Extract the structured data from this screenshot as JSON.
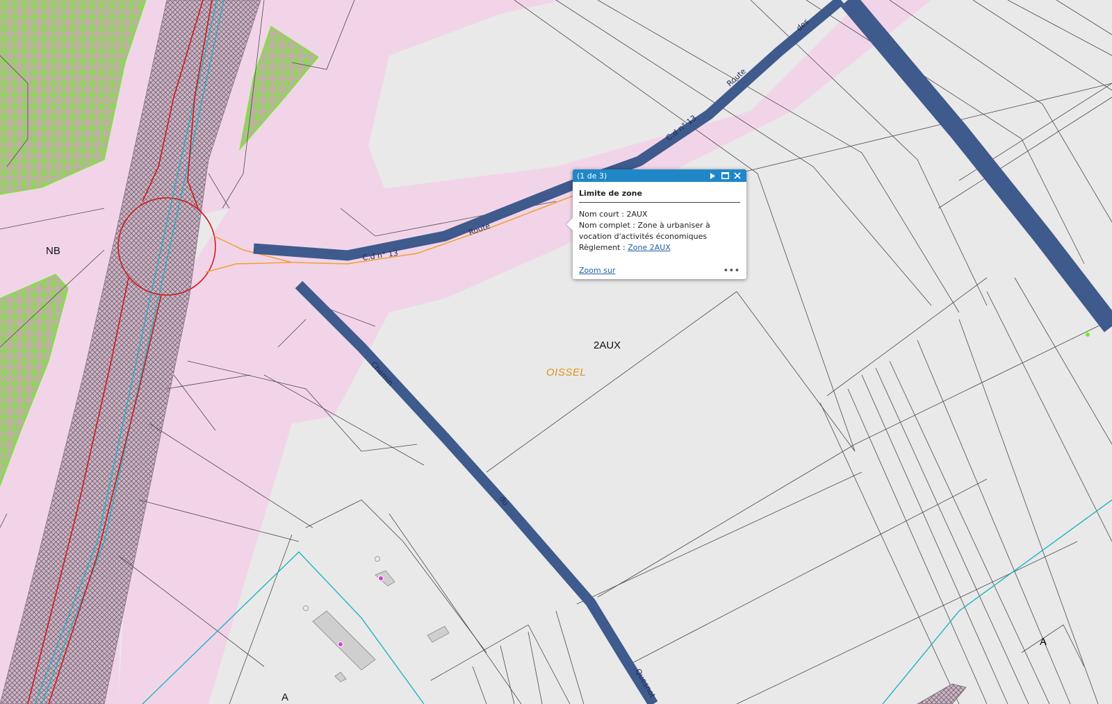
{
  "map": {
    "zones": [
      "NB",
      "2AUX",
      "A",
      "A"
    ],
    "commune": "OISSEL",
    "roads": {
      "cd13_a": "C.d n° 13",
      "route_a": "Route",
      "cd13_b": "C.d n° 13",
      "route_b": "Route",
      "des": "des",
      "chemin": "Chemin",
      "du": "du",
      "quesnot": "Quesnot"
    },
    "colors": {
      "background": "#e9e9e9",
      "pink_zone": "#f2d4e8",
      "road_blue": "#3f5a8c",
      "parcel_line": "#4a4a4a",
      "cyan_line": "#1fb3c4",
      "red_line": "#cf1a1a",
      "orange_line": "#f0a030",
      "green_wood": "#b9b49a"
    }
  },
  "popup": {
    "count": "(1 de 3)",
    "title": "Limite de zone",
    "nom_court_label": "Nom court : ",
    "nom_court": "2AUX",
    "nom_complet_label": "Nom complet : ",
    "nom_complet": "Zone à urbaniser à vocation d'activités économiques",
    "reglement_label": "Règlement : ",
    "reglement_link": "Zone 2AUX",
    "zoom_link": "Zoom sur",
    "more": "•••",
    "icons": [
      "next-icon",
      "maximize-icon",
      "close-icon"
    ]
  }
}
